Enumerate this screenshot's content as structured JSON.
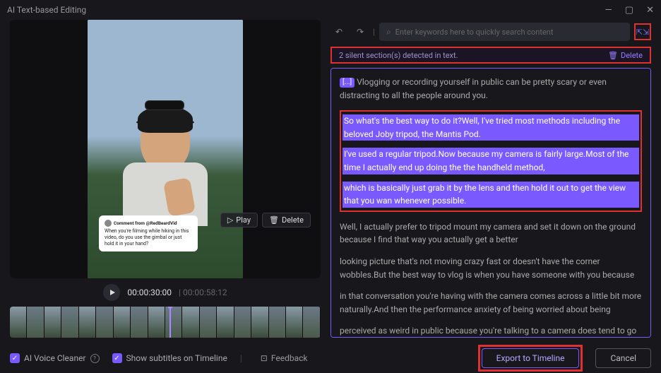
{
  "window": {
    "title": "AI Text-based Editing"
  },
  "video": {
    "play_label": "Play",
    "delete_label": "Delete",
    "current_time": "00:00:30:00",
    "duration": "00:00:58:12",
    "comment": {
      "author": "Comment from @RedBeardVid",
      "body": "When you're filming while hiking in this video, do you use the gimbal or just hold it in your hand?"
    }
  },
  "search": {
    "placeholder": "Enter keywords here to quickly search content"
  },
  "silent": {
    "text": "2 silent section(s) detected in text.",
    "delete_label": "Delete"
  },
  "transcript": {
    "p1": "Vlogging or recording yourself in public can be pretty scary or even distracting to all the people around you.",
    "sel1": "So what's the best way to do it?Well, I've tried most methods including the beloved Joby tripod, the Mantis Pod.",
    "sel2": "I've used a regular tripod.Now because my camera is fairly large.Most of the time I actually end up doing the the handheld method,",
    "sel3": " which is basically just grab it by the lens and then hold it out to get the view that you wan whenever possible.",
    "p2": "Well, I actually prefer to tripod mount my camera and set it down on the ground because I find that way you actually get a better",
    "p3": " looking picture that's not moving crazy fast or doesn't have the corner wobbles.But the best way to vlog is when you have someone with you because",
    "p4": " in that conversation you're having with the camera comes across a little bit more naturally.And then the performance anxiety of being worried about being",
    "p5": " perceived as weird in public because you're talking to a camera does tend to go "
  },
  "footer": {
    "ai_voice_cleaner": "AI Voice Cleaner",
    "subtitles": "Show subtitles on Timeline",
    "feedback": "Feedback",
    "export": "Export to Timeline",
    "cancel": "Cancel"
  }
}
